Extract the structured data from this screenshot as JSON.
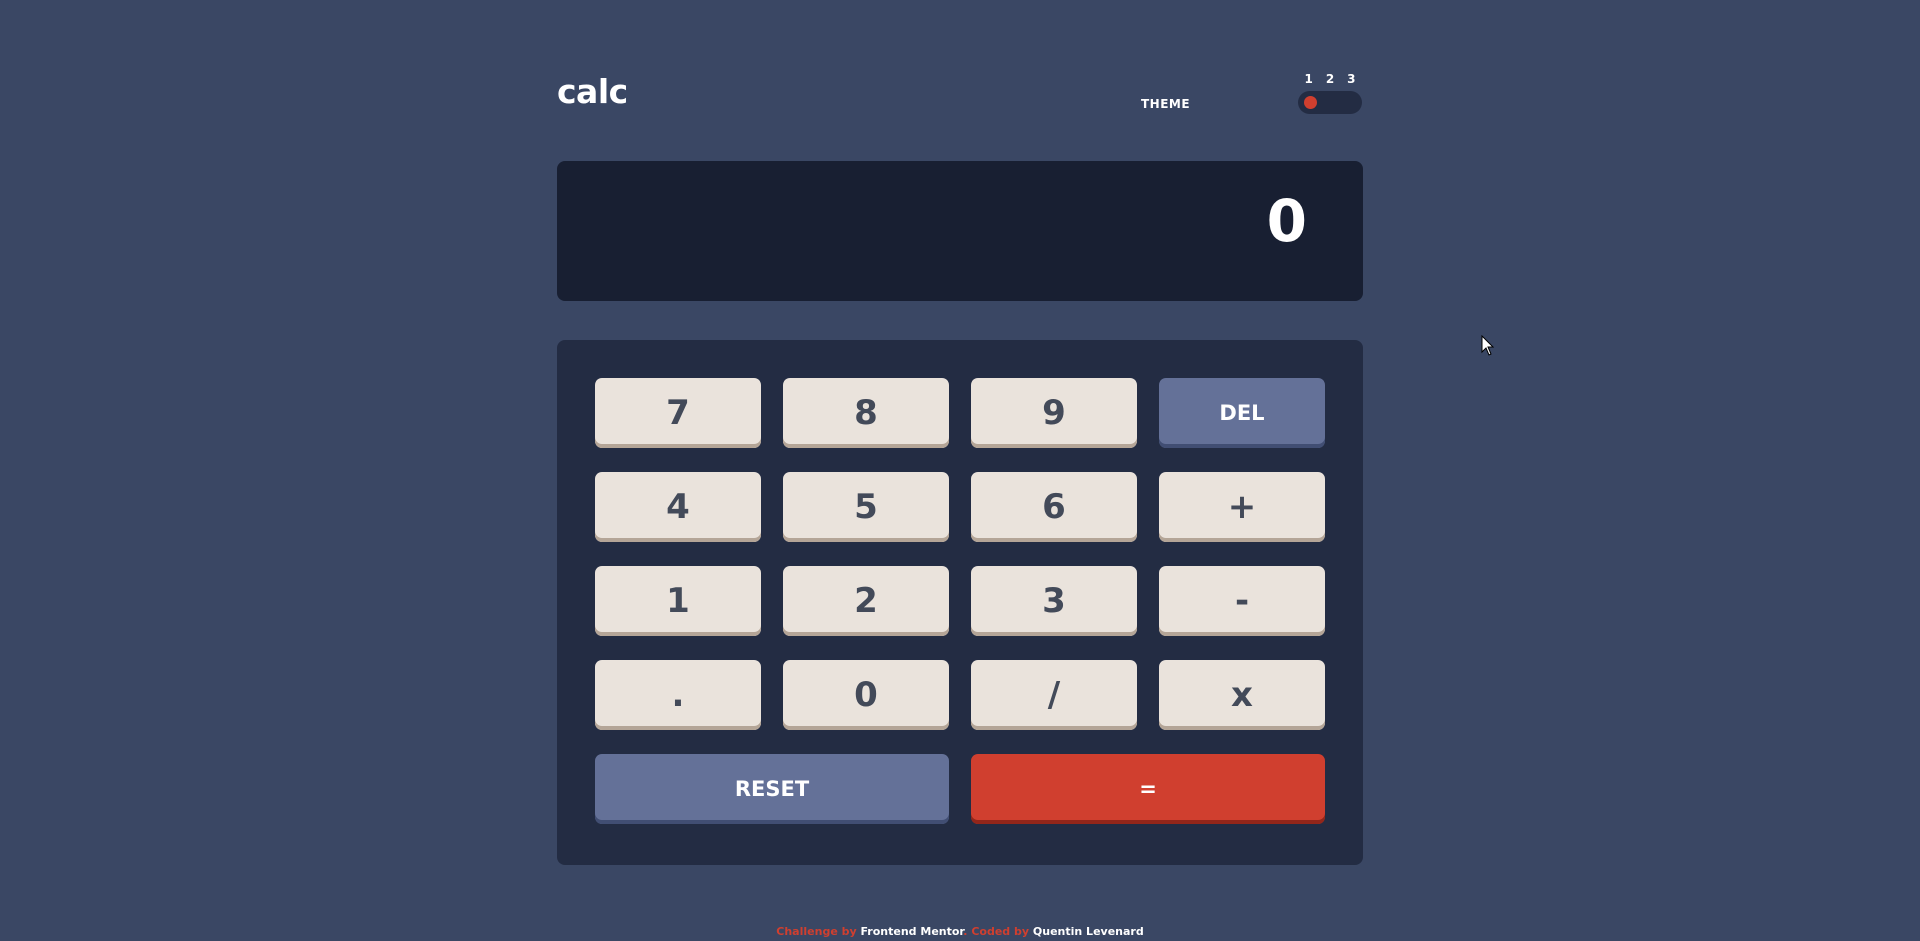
{
  "header": {
    "logo": "calc",
    "theme_label": "THEME",
    "theme_options": [
      "1",
      "2",
      "3"
    ],
    "selected_theme": 1
  },
  "display": {
    "value": "0"
  },
  "keys": {
    "k7": "7",
    "k8": "8",
    "k9": "9",
    "del": "DEL",
    "k4": "4",
    "k5": "5",
    "k6": "6",
    "plus": "+",
    "k1": "1",
    "k2": "2",
    "k3": "3",
    "minus": "-",
    "dot": ".",
    "k0": "0",
    "divide": "/",
    "multiply": "x",
    "reset": "RESET",
    "equals": "="
  },
  "footer": {
    "challenge_by": "Challenge by",
    "frontend_mentor": "Frontend Mentor",
    "separator": ".",
    "coded_by": "Coded by",
    "author": "Quentin Levenard"
  },
  "colors": {
    "background": "#3a4764",
    "screen": "#181f32",
    "keypad": "#232c43",
    "key": "#eae3dc",
    "key_text": "#434a59",
    "del_reset": "#647198",
    "accent": "#d03f2f"
  },
  "icons": {
    "cursor": "mouse-pointer-icon"
  }
}
